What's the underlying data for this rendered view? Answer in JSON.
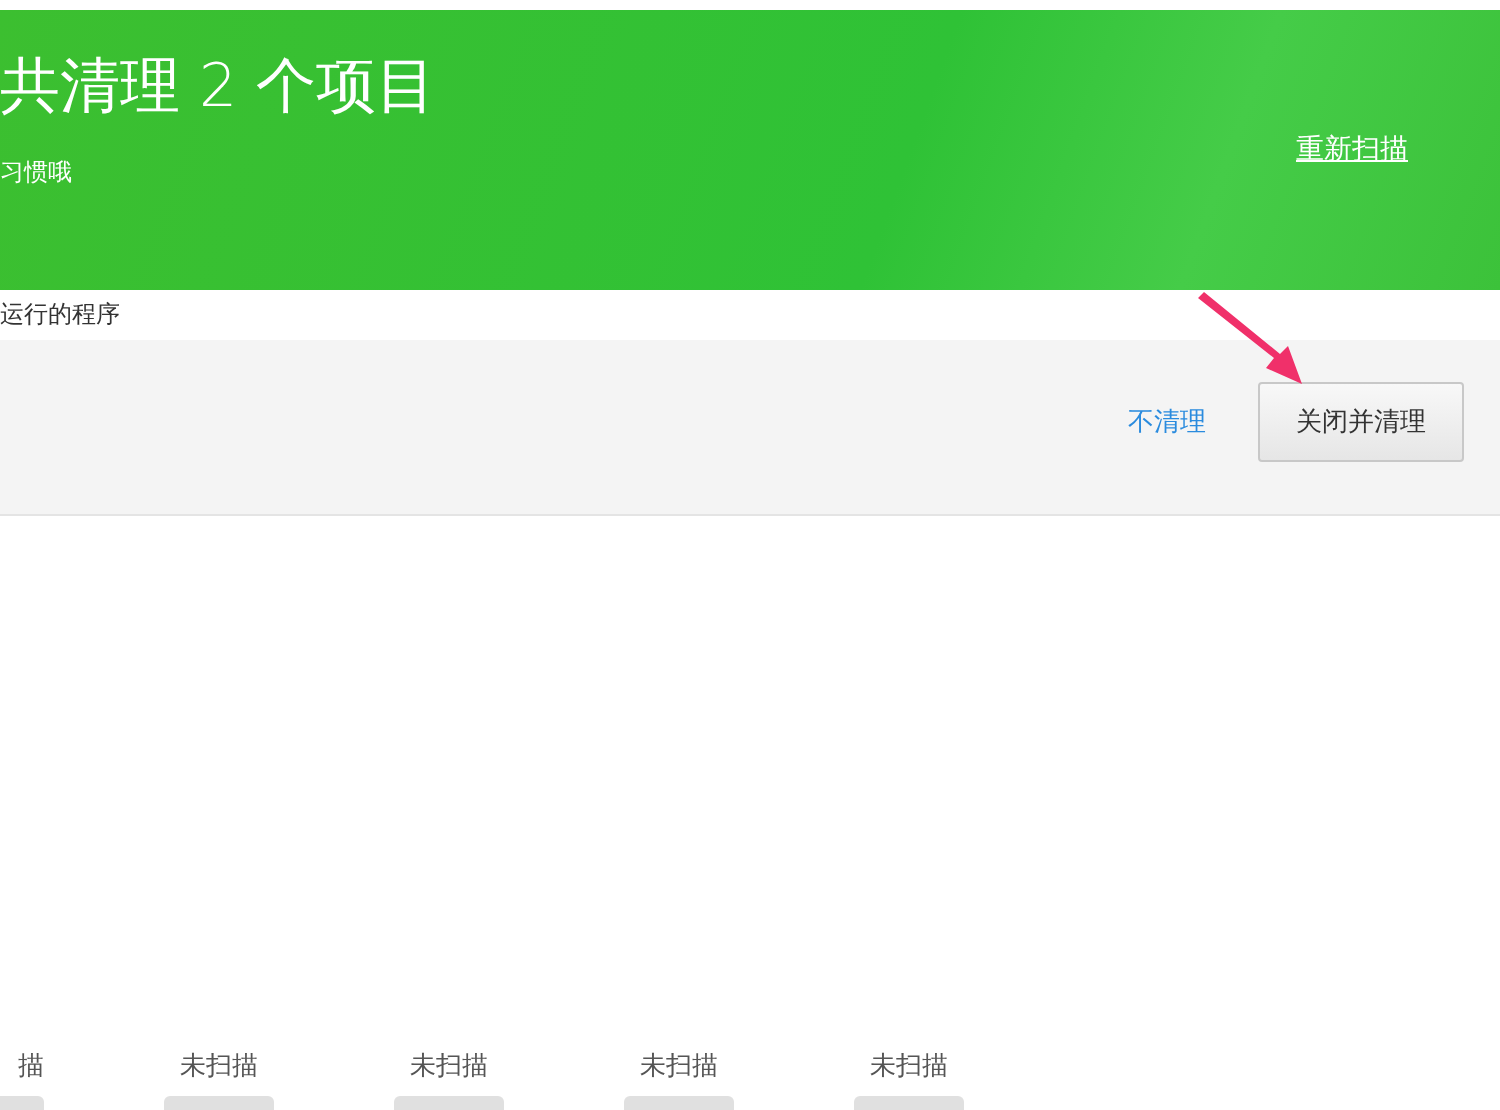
{
  "header": {
    "title": "共清理 2 个项目",
    "subtitle": "习惯哦",
    "rescan_link": "重新扫描"
  },
  "section": {
    "title": "运行的程序"
  },
  "actions": {
    "skip_link": "不清理",
    "close_button": "关闭并清理"
  },
  "scan_items": [
    {
      "label": "描"
    },
    {
      "label": "未扫描"
    },
    {
      "label": "未扫描"
    },
    {
      "label": "未扫描"
    },
    {
      "label": "未扫描"
    }
  ]
}
